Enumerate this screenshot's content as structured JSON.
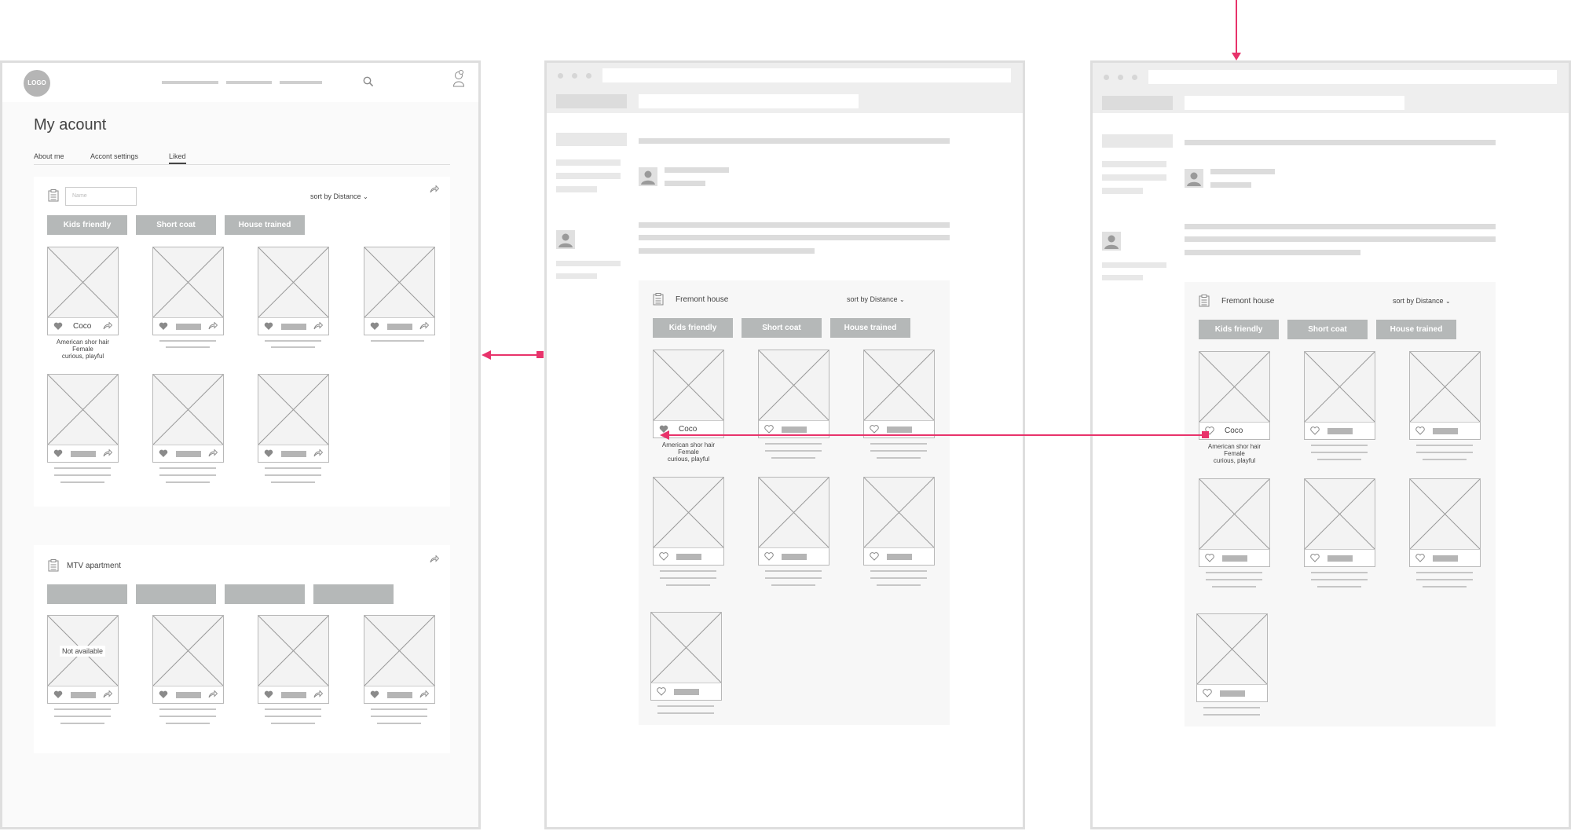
{
  "left": {
    "logo": "LOGO",
    "page_title": "My acount",
    "tabs": [
      "About me",
      "Accont settings",
      "Liked"
    ],
    "active_tab": "Liked",
    "name_placeholder": "Name",
    "sort_label": "sort by Distance",
    "tags": [
      "Kids friendly",
      "Short coat",
      "House trained"
    ],
    "card": {
      "name": "Coco",
      "breed": "American shor hair",
      "sex": "Female",
      "traits": "curious, playful"
    },
    "group2_title": "MTV apartment",
    "not_available": "Not available"
  },
  "middle": {
    "group_title": "Fremont house",
    "sort_label": "sort by Distance",
    "tags": [
      "Kids friendly",
      "Short coat",
      "House trained"
    ],
    "card": {
      "name": "Coco",
      "breed": "American shor hair",
      "sex": "Female",
      "traits": "curious, playful"
    }
  },
  "right": {
    "group_title": "Fremont house",
    "sort_label": "sort by Distance",
    "tags": [
      "Kids friendly",
      "Short coat",
      "House trained"
    ],
    "card": {
      "name": "Coco",
      "breed": "American shor hair",
      "sex": "Female",
      "traits": "curious, playful"
    }
  },
  "colors": {
    "accent": "#e8336b",
    "tag": "#b5b8b8",
    "frame": "#dedede"
  }
}
